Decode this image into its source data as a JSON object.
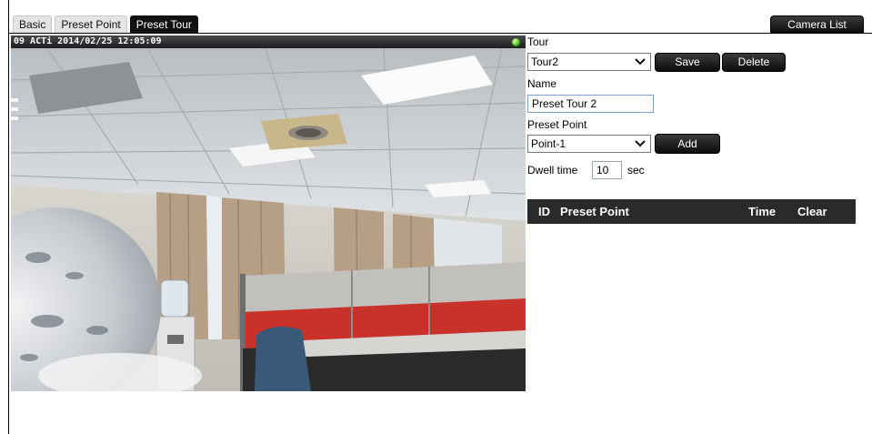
{
  "tabs": [
    {
      "label": "Basic",
      "active": false
    },
    {
      "label": "Preset Point",
      "active": false
    },
    {
      "label": "Preset Tour",
      "active": true
    }
  ],
  "camera_list_label": "Camera List",
  "video": {
    "overlay_text": "09 ACTi  2014/02/25 12:05:09",
    "status_color": "#3eb51a"
  },
  "tour": {
    "label": "Tour",
    "selected": "Tour2",
    "save_label": "Save",
    "delete_label": "Delete"
  },
  "name": {
    "label": "Name",
    "value": "Preset Tour 2"
  },
  "preset_point": {
    "label": "Preset Point",
    "selected": "Point-1",
    "add_label": "Add"
  },
  "dwell": {
    "label": "Dwell time",
    "value": "10",
    "unit": "sec"
  },
  "table": {
    "columns": [
      "ID",
      "Preset Point",
      "Time",
      "Clear"
    ],
    "rows": []
  },
  "colors": {
    "tab_active_bg": "#111111",
    "header_bg": "#2a2a2a",
    "button_bg": "#1a1a1a"
  }
}
